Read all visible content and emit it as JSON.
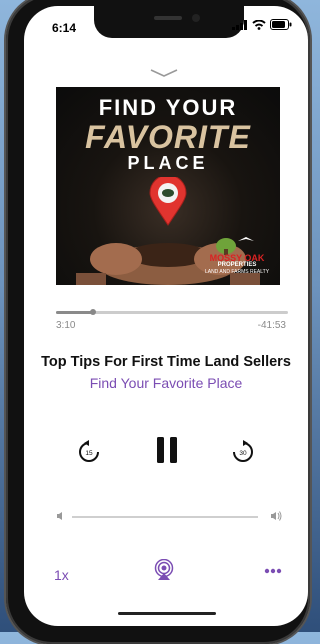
{
  "status_bar": {
    "time": "6:14"
  },
  "artwork": {
    "line1": "FIND YOUR",
    "line2": "FAVORITE",
    "line3": "PLACE",
    "logo_text1": "MOSSY OAK",
    "logo_text2": "PROPERTIES",
    "logo_text3": "LAND AND FARMS REALTY"
  },
  "player": {
    "elapsed": "3:10",
    "remaining": "-41:53",
    "progress_fraction": 0.16,
    "episode_title": "Top Tips For First Time Land Sellers",
    "show_title": "Find Your Favorite Place",
    "skip_back_seconds": "15",
    "skip_forward_seconds": "30",
    "speed": "1x",
    "volume_fraction": 1.0
  },
  "colors": {
    "accent": "#7b4db3",
    "pin": "#e1342f"
  },
  "icons": {
    "dismiss": "chevron-down-icon",
    "skip_back": "skip-back-15-icon",
    "pause": "pause-icon",
    "skip_forward": "skip-forward-30-icon",
    "airplay": "podcast-airplay-icon",
    "more": "more-icon"
  }
}
